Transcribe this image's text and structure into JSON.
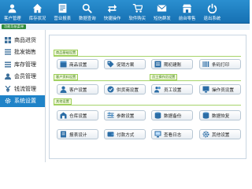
{
  "toolbar": {
    "items": [
      {
        "label": "客户管理",
        "icon": "users-icon"
      },
      {
        "label": "库存状况",
        "icon": "home-icon"
      },
      {
        "label": "营业报表",
        "icon": "report-icon"
      },
      {
        "label": "数据查询",
        "icon": "search-icon"
      },
      {
        "label": "快捷操作",
        "icon": "swap-icon"
      },
      {
        "label": "软件购买",
        "icon": "cart-icon"
      },
      {
        "label": "短信群发",
        "icon": "mail-icon"
      },
      {
        "label": "前台零售",
        "icon": "store-icon"
      },
      {
        "label": "退出系统",
        "icon": "power-icon"
      }
    ]
  },
  "breadcrumb": "功能导航菜单",
  "sidebar": {
    "items": [
      {
        "label": "商品进货"
      },
      {
        "label": "批发销售"
      },
      {
        "label": "库存管理"
      },
      {
        "label": "会员管理"
      },
      {
        "label": "钱流管理"
      },
      {
        "label": "系统设置"
      }
    ],
    "active_index": 5
  },
  "sections": [
    {
      "title": "商品基础设置",
      "buttons": [
        "商品设置",
        "促销方案",
        "期初建账",
        "条码打印"
      ]
    },
    {
      "titles": [
        "客户资料设置",
        "员工操作员设置"
      ],
      "buttons": [
        "客户设置",
        "供货商设置",
        "员工设置",
        "操作员设置"
      ]
    },
    {
      "title": "其他设置",
      "buttons": [
        "仓库设置",
        "参数设置",
        "数据备份",
        "数据恢复",
        "报表设计",
        "付款方式",
        "查看日志",
        "其他设置"
      ]
    }
  ],
  "colors": {
    "toolbar": "#1f7fc2",
    "active": "#1f83c8",
    "section_tag": "#3b7d16"
  }
}
